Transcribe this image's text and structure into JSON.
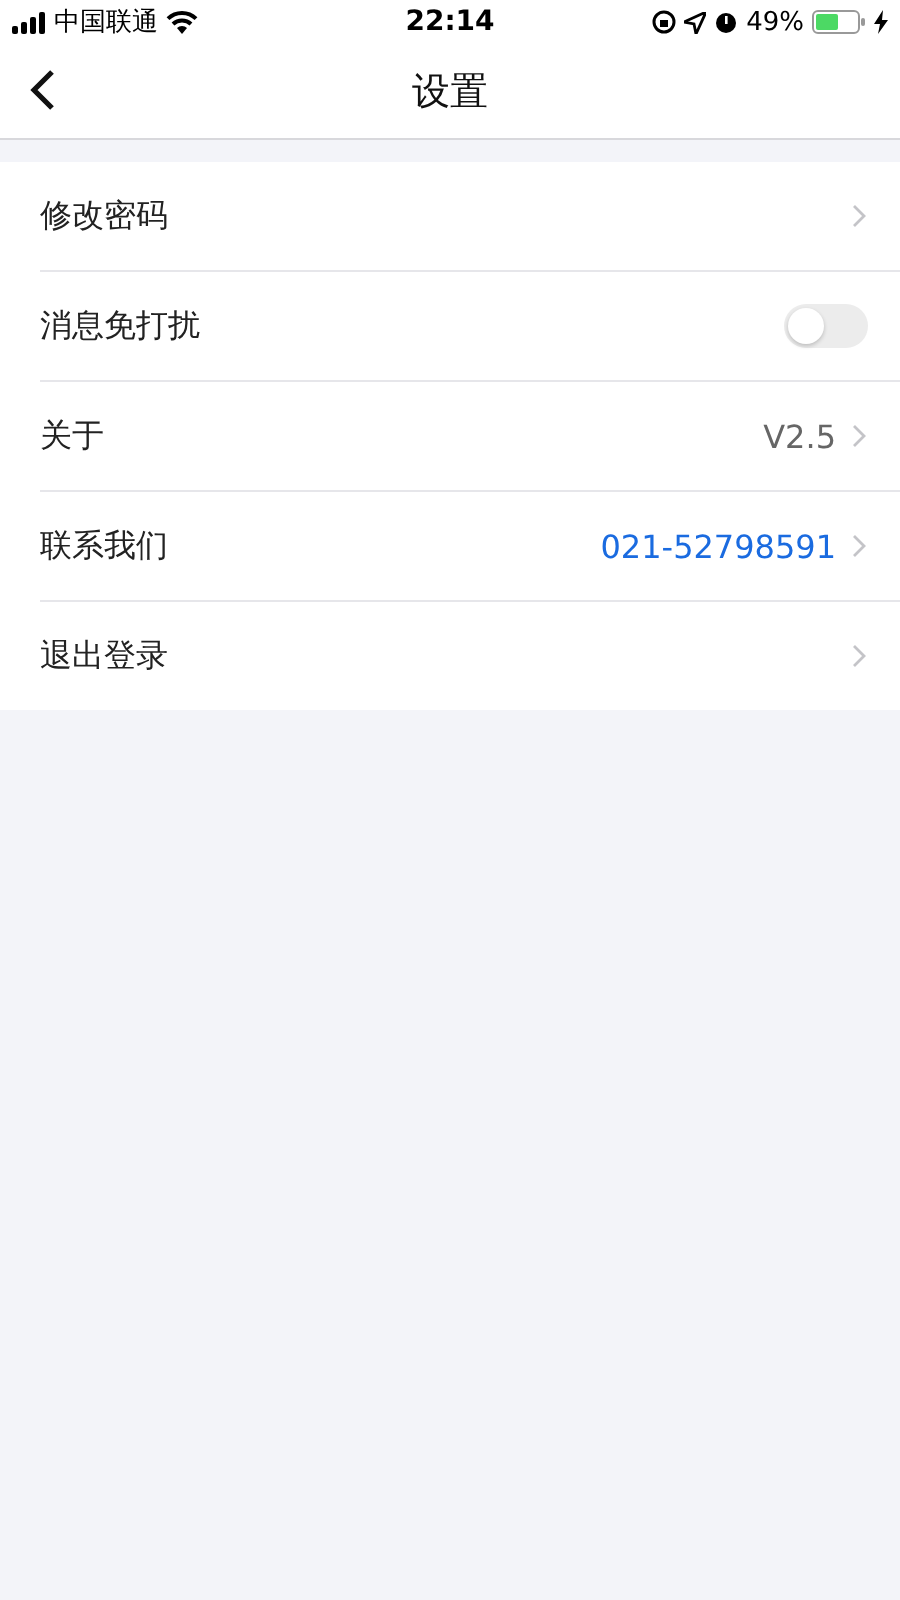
{
  "status_bar": {
    "carrier": "中国联通",
    "time": "22:14",
    "battery": "49%"
  },
  "nav": {
    "title": "设置"
  },
  "rows": [
    {
      "kind": "link",
      "label": "修改密码"
    },
    {
      "kind": "toggle",
      "label": "消息免打扰",
      "on": false
    },
    {
      "kind": "value",
      "label": "关于",
      "value": "V2.5"
    },
    {
      "kind": "phone",
      "label": "联系我们",
      "value": "021-52798591"
    },
    {
      "kind": "link",
      "label": "退出登录"
    }
  ]
}
